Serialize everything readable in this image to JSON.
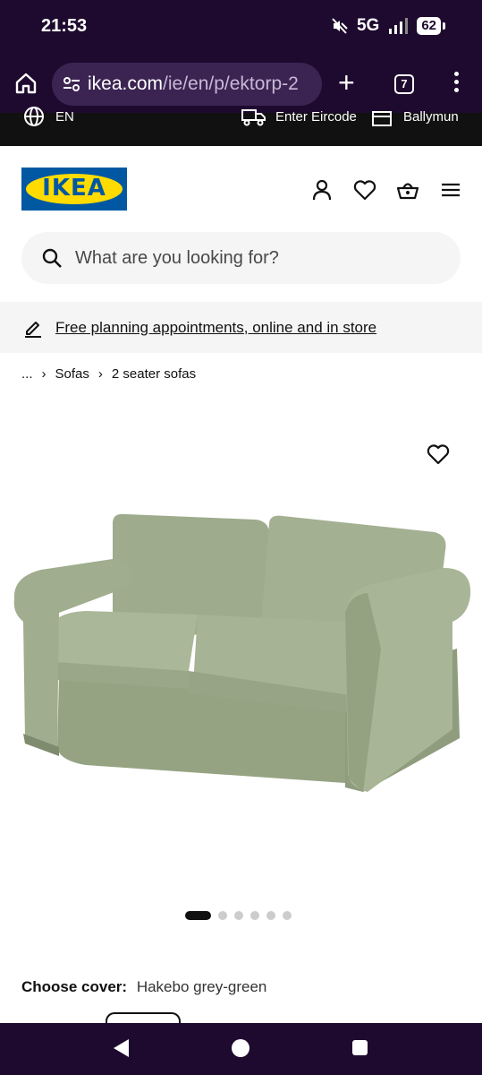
{
  "status_bar": {
    "time": "21:53",
    "network": "5G",
    "battery": "62"
  },
  "browser": {
    "url_host": "ikea.com",
    "url_path": "/ie/en/p/ektorp-2",
    "tab_count": "7"
  },
  "top_strip": {
    "language": "EN",
    "eircode": "Enter Eircode",
    "store": "Ballymun"
  },
  "logo": {
    "text": "IKEA"
  },
  "search": {
    "placeholder": "What are you looking for?"
  },
  "promo": {
    "text": "Free planning appointments, online and in store"
  },
  "breadcrumb": {
    "ellipsis": "...",
    "items": [
      "Sofas",
      "2 seater sofas"
    ]
  },
  "gallery": {
    "image_count": 6,
    "active_index": 0,
    "sofa_color": "#a3b092"
  },
  "product": {
    "choose_cover_label": "Choose cover:",
    "cover_value": "Hakebo grey-green"
  },
  "colors": {
    "system_bar": "#1e0a2e",
    "ikea_blue": "#0058a3",
    "ikea_yellow": "#ffdb00"
  }
}
